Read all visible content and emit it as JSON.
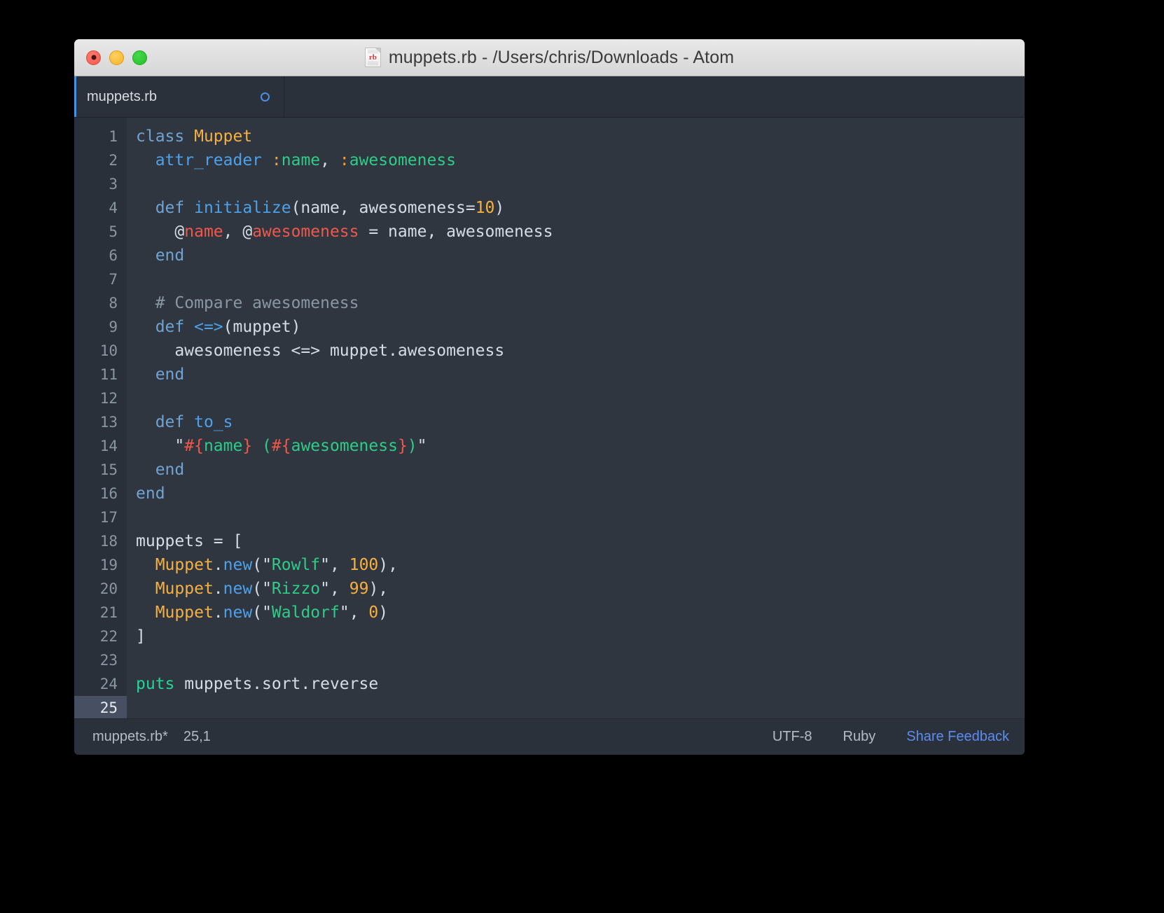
{
  "window": {
    "title": "muppets.rb - /Users/chris/Downloads - Atom",
    "file_icon_label": "rb",
    "traffic_lights": [
      "close",
      "minimize",
      "maximize"
    ]
  },
  "tabs": [
    {
      "label": "muppets.rb",
      "modified": true
    }
  ],
  "editor": {
    "active_line": 25,
    "line_numbers": [
      "1",
      "2",
      "3",
      "4",
      "5",
      "6",
      "7",
      "8",
      "9",
      "10",
      "11",
      "12",
      "13",
      "14",
      "15",
      "16",
      "17",
      "18",
      "19",
      "20",
      "21",
      "22",
      "23",
      "24",
      "25"
    ],
    "lines": [
      "class Muppet",
      "  attr_reader :name, :awesomeness",
      "",
      "  def initialize(name, awesomeness=10)",
      "    @name, @awesomeness = name, awesomeness",
      "  end",
      "",
      "  # Compare awesomeness",
      "  def <=>(muppet)",
      "    awesomeness <=> muppet.awesomeness",
      "  end",
      "",
      "  def to_s",
      "    \"#{name} (#{awesomeness})\"",
      "  end",
      "end",
      "",
      "muppets = [",
      "  Muppet.new(\"Rowlf\", 100),",
      "  Muppet.new(\"Rizzo\", 99),",
      "  Muppet.new(\"Waldorf\", 0)",
      "]",
      "",
      "puts muppets.sort.reverse",
      ""
    ],
    "tokens": [
      [
        {
          "t": "class ",
          "c": "t-key"
        },
        {
          "t": "Muppet",
          "c": "t-class"
        }
      ],
      [
        {
          "t": "  ",
          "c": "t-plain"
        },
        {
          "t": "attr_reader",
          "c": "t-fn"
        },
        {
          "t": " ",
          "c": "t-plain"
        },
        {
          "t": ":",
          "c": "t-symc"
        },
        {
          "t": "name",
          "c": "t-sym"
        },
        {
          "t": ", ",
          "c": "t-plain"
        },
        {
          "t": ":",
          "c": "t-symc"
        },
        {
          "t": "awesomeness",
          "c": "t-sym"
        }
      ],
      [],
      [
        {
          "t": "  ",
          "c": "t-plain"
        },
        {
          "t": "def ",
          "c": "t-key"
        },
        {
          "t": "initialize",
          "c": "t-fn"
        },
        {
          "t": "(name, awesomeness=",
          "c": "t-plain"
        },
        {
          "t": "10",
          "c": "t-num"
        },
        {
          "t": ")",
          "c": "t-plain"
        }
      ],
      [
        {
          "t": "    @",
          "c": "t-plain"
        },
        {
          "t": "name",
          "c": "t-ivar"
        },
        {
          "t": ", @",
          "c": "t-plain"
        },
        {
          "t": "awesomeness",
          "c": "t-ivar"
        },
        {
          "t": " = name, awesomeness",
          "c": "t-plain"
        }
      ],
      [
        {
          "t": "  ",
          "c": "t-plain"
        },
        {
          "t": "end",
          "c": "t-key"
        }
      ],
      [],
      [
        {
          "t": "  ",
          "c": "t-plain"
        },
        {
          "t": "# Compare awesomeness",
          "c": "t-cmt"
        }
      ],
      [
        {
          "t": "  ",
          "c": "t-plain"
        },
        {
          "t": "def ",
          "c": "t-key"
        },
        {
          "t": "<=>",
          "c": "t-fn"
        },
        {
          "t": "(muppet)",
          "c": "t-plain"
        }
      ],
      [
        {
          "t": "    awesomeness <=> muppet.awesomeness",
          "c": "t-plain"
        }
      ],
      [
        {
          "t": "  ",
          "c": "t-plain"
        },
        {
          "t": "end",
          "c": "t-key"
        }
      ],
      [],
      [
        {
          "t": "  ",
          "c": "t-plain"
        },
        {
          "t": "def ",
          "c": "t-key"
        },
        {
          "t": "to_s",
          "c": "t-fn"
        }
      ],
      [
        {
          "t": "    ",
          "c": "t-plain"
        },
        {
          "t": "\"",
          "c": "t-quote"
        },
        {
          "t": "#{",
          "c": "t-interp"
        },
        {
          "t": "name",
          "c": "t-str"
        },
        {
          "t": "}",
          "c": "t-interp"
        },
        {
          "t": " (",
          "c": "t-str"
        },
        {
          "t": "#{",
          "c": "t-interp"
        },
        {
          "t": "awesomeness",
          "c": "t-str"
        },
        {
          "t": "}",
          "c": "t-interp"
        },
        {
          "t": ")",
          "c": "t-str"
        },
        {
          "t": "\"",
          "c": "t-quote"
        }
      ],
      [
        {
          "t": "  ",
          "c": "t-plain"
        },
        {
          "t": "end",
          "c": "t-key"
        }
      ],
      [
        {
          "t": "end",
          "c": "t-key"
        }
      ],
      [],
      [
        {
          "t": "muppets = [",
          "c": "t-plain"
        }
      ],
      [
        {
          "t": "  ",
          "c": "t-plain"
        },
        {
          "t": "Muppet",
          "c": "t-class"
        },
        {
          "t": ".",
          "c": "t-plain"
        },
        {
          "t": "new",
          "c": "t-fn"
        },
        {
          "t": "(",
          "c": "t-plain"
        },
        {
          "t": "\"",
          "c": "t-quote"
        },
        {
          "t": "Rowlf",
          "c": "t-str"
        },
        {
          "t": "\"",
          "c": "t-quote"
        },
        {
          "t": ", ",
          "c": "t-plain"
        },
        {
          "t": "100",
          "c": "t-num"
        },
        {
          "t": "),",
          "c": "t-plain"
        }
      ],
      [
        {
          "t": "  ",
          "c": "t-plain"
        },
        {
          "t": "Muppet",
          "c": "t-class"
        },
        {
          "t": ".",
          "c": "t-plain"
        },
        {
          "t": "new",
          "c": "t-fn"
        },
        {
          "t": "(",
          "c": "t-plain"
        },
        {
          "t": "\"",
          "c": "t-quote"
        },
        {
          "t": "Rizzo",
          "c": "t-str"
        },
        {
          "t": "\"",
          "c": "t-quote"
        },
        {
          "t": ", ",
          "c": "t-plain"
        },
        {
          "t": "99",
          "c": "t-num"
        },
        {
          "t": "),",
          "c": "t-plain"
        }
      ],
      [
        {
          "t": "  ",
          "c": "t-plain"
        },
        {
          "t": "Muppet",
          "c": "t-class"
        },
        {
          "t": ".",
          "c": "t-plain"
        },
        {
          "t": "new",
          "c": "t-fn"
        },
        {
          "t": "(",
          "c": "t-plain"
        },
        {
          "t": "\"",
          "c": "t-quote"
        },
        {
          "t": "Waldorf",
          "c": "t-str"
        },
        {
          "t": "\"",
          "c": "t-quote"
        },
        {
          "t": ", ",
          "c": "t-plain"
        },
        {
          "t": "0",
          "c": "t-num"
        },
        {
          "t": ")",
          "c": "t-plain"
        }
      ],
      [
        {
          "t": "]",
          "c": "t-plain"
        }
      ],
      [],
      [
        {
          "t": "puts",
          "c": "t-puts"
        },
        {
          "t": " muppets.sort.reverse",
          "c": "t-plain"
        }
      ],
      []
    ]
  },
  "statusbar": {
    "file_name": "muppets.rb*",
    "cursor_position": "25,1",
    "encoding": "UTF-8",
    "grammar": "Ruby",
    "feedback_label": "Share Feedback"
  },
  "colors": {
    "accent_blue": "#4a90e2",
    "link_blue": "#5b8def",
    "editor_bg": "#2f3640",
    "gutter_bg": "#2a303a",
    "chrome_bg": "#2b313b",
    "keyword": "#6fa3d2",
    "class_name": "#f5b041",
    "function": "#4ea1e8",
    "string": "#2ecc87",
    "number": "#f5b041",
    "instance_var": "#f0584a",
    "comment": "#8b96a3",
    "puts_green": "#25d39a"
  }
}
